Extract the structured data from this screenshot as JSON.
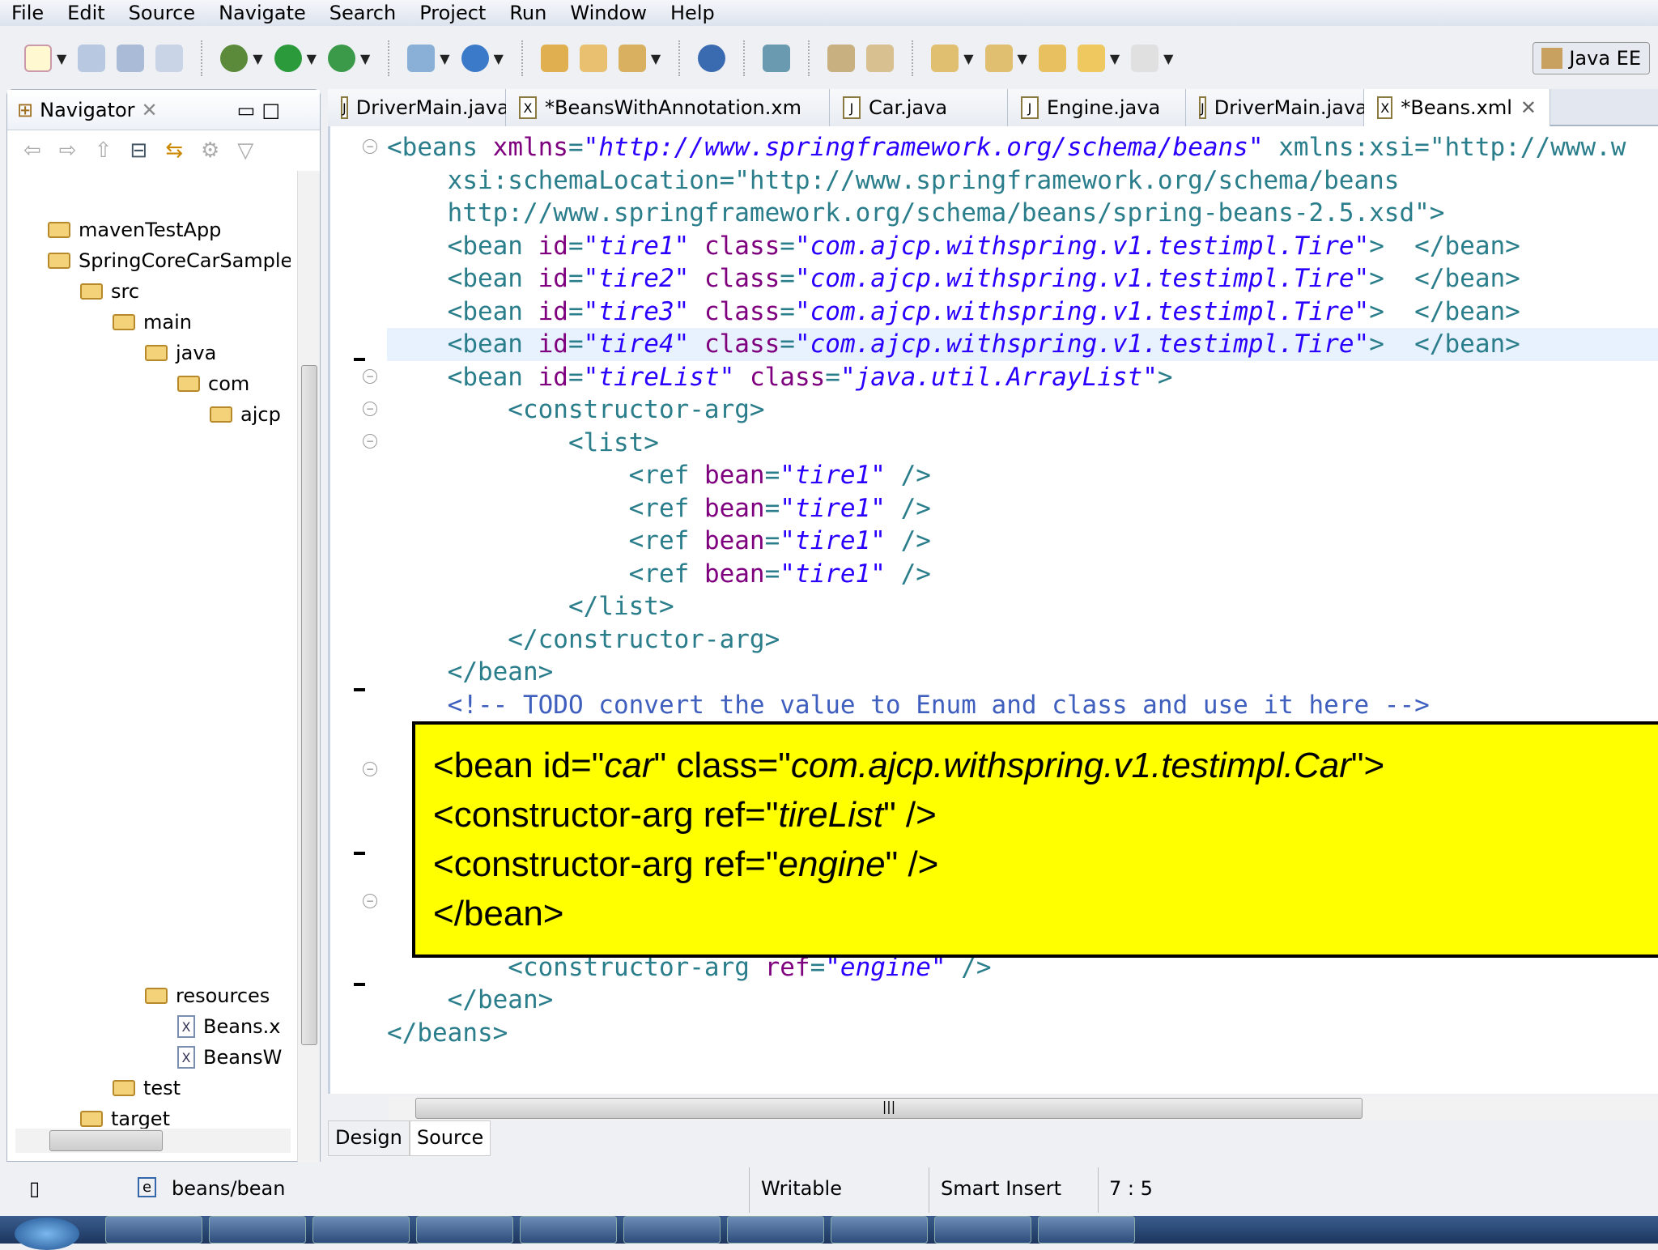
{
  "menu": [
    "File",
    "Edit",
    "Source",
    "Navigate",
    "Search",
    "Project",
    "Run",
    "Window",
    "Help"
  ],
  "perspective": "Java EE",
  "navigator": {
    "title": "Navigator",
    "tree": [
      {
        "label": "mavenTestApp",
        "level": 0
      },
      {
        "label": "SpringCoreCarSample",
        "level": 0
      },
      {
        "label": "src",
        "level": 1
      },
      {
        "label": "main",
        "level": 2
      },
      {
        "label": "java",
        "level": 3
      },
      {
        "label": "com",
        "level": 4
      },
      {
        "label": "ajcp",
        "level": 5
      },
      {
        "label": "resources",
        "level": 3
      },
      {
        "label": "Beans.x",
        "level": 4
      },
      {
        "label": "BeansW",
        "level": 4
      },
      {
        "label": "test",
        "level": 2
      },
      {
        "label": "target",
        "level": 1
      }
    ]
  },
  "tabs": [
    {
      "label": "DriverMain.java",
      "type": "J"
    },
    {
      "label": "*BeansWithAnnotation.xm",
      "type": "X"
    },
    {
      "label": "Car.java",
      "type": "J"
    },
    {
      "label": "Engine.java",
      "type": "J"
    },
    {
      "label": "DriverMain.java",
      "type": "J"
    },
    {
      "label": "*Beans.xml",
      "type": "X",
      "active": true
    }
  ],
  "code": [
    "<beans xmlns=\"http://www.springframework.org/schema/beans\" xmlns:xsi=\"http://www.w",
    "    xsi:schemaLocation=\"http://www.springframework.org/schema/beans",
    "    http://www.springframework.org/schema/beans/spring-beans-2.5.xsd\">",
    "    <bean id=\"tire1\" class=\"com.ajcp.withspring.v1.testimpl.Tire\">  </bean>",
    "    <bean id=\"tire2\" class=\"com.ajcp.withspring.v1.testimpl.Tire\">  </bean>",
    "    <bean id=\"tire3\" class=\"com.ajcp.withspring.v1.testimpl.Tire\">  </bean>",
    "    <bean id=\"tire4\" class=\"com.ajcp.withspring.v1.testimpl.Tire\">  </bean>",
    "    <bean id=\"tireList\" class=\"java.util.ArrayList\">",
    "        <constructor-arg>",
    "            <list>",
    "                <ref bean=\"tire1\" />",
    "                <ref bean=\"tire1\" />",
    "                <ref bean=\"tire1\" />",
    "                <ref bean=\"tire1\" />",
    "            </list>",
    "        </constructor-arg>",
    "    </bean>",
    "    <!-- TODO convert the value to Enum and class and use it here -->",
    "",
    "",
    "",
    "",
    "",
    "",
    "",
    "        <constructor-arg ref=\"engine\" />",
    "    </bean>",
    "</beans>"
  ],
  "callout": {
    "line1_a": "<bean id=\"",
    "line1_b": "car",
    "line1_c": "\" class=\"",
    "line1_d": "com.ajcp.withspring.v1.testimpl.Car",
    "line1_e": "\">",
    "line2_a": "<constructor-arg ref=\"",
    "line2_b": "tireList",
    "line2_c": "\" />",
    "line3_a": "<constructor-arg ref=\"",
    "line3_b": "engine",
    "line3_c": "\" />",
    "line4": "</bean>"
  },
  "bottom_tabs": [
    "Design",
    "Source"
  ],
  "status": {
    "path": "beans/bean",
    "mode": "Writable",
    "insert": "Smart Insert",
    "position": "7 : 5"
  }
}
